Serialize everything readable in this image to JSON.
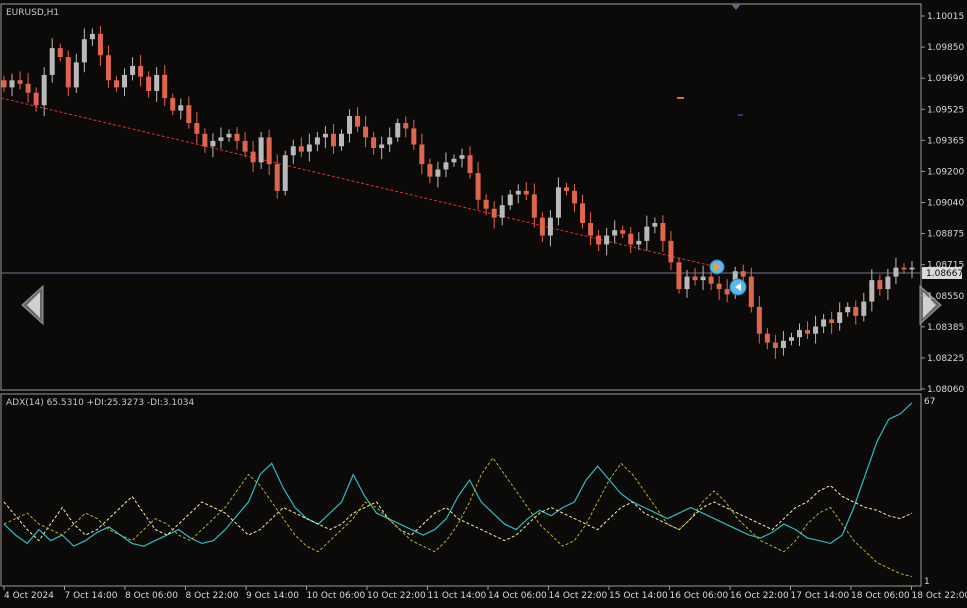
{
  "symbol_label": "EURUSD,H1",
  "indicator_label": "ADX(14) 65.5310 +DI:25.3273 -DI:3.1034",
  "current_price": "1.08667",
  "price_axis": [
    "1.10015",
    "1.09850",
    "1.09690",
    "1.09525",
    "1.09365",
    "1.09200",
    "1.09040",
    "1.08875",
    "1.08715",
    "1.08550",
    "1.08385",
    "1.08225",
    "1.08060"
  ],
  "indicator_axis": [
    "67",
    "1"
  ],
  "time_axis": [
    "4 Oct 2024",
    "7 Oct 14:00",
    "8 Oct 06:00",
    "8 Oct 22:00",
    "9 Oct 14:00",
    "10 Oct 06:00",
    "10 Oct 22:00",
    "11 Oct 14:00",
    "14 Oct 06:00",
    "14 Oct 22:00",
    "15 Oct 14:00",
    "16 Oct 06:00",
    "16 Oct 22:00",
    "17 Oct 14:00",
    "18 Oct 06:00",
    "18 Oct 22:00"
  ],
  "colors": {
    "background": "#0c0a08",
    "bull": "#b9b9b9",
    "bear": "#e0654d",
    "trendline": "#e03030",
    "adx": "#2fb9bf",
    "plus_di": "#f0f0b0",
    "minus_di": "#a8b436",
    "grid": "#3a3a3a",
    "price_line": "#6f7890"
  },
  "icons": {
    "nav_left": "left-arrow-icon",
    "nav_right": "right-arrow-icon",
    "sell_marker": "trade-marker-sell-icon",
    "buy_marker": "trade-marker-buy-icon"
  },
  "chart_data": [
    {
      "type": "candlestick",
      "title": "EURUSD,H1",
      "ylim": [
        1.0799,
        1.1008
      ],
      "close_series": [
        1.0968,
        1.0972,
        1.097,
        1.0965,
        1.0958,
        1.0975,
        1.099,
        1.0985,
        1.0968,
        1.0982,
        1.0995,
        1.0998,
        1.0986,
        1.0972,
        1.0968,
        1.0975,
        1.098,
        1.0974,
        1.0966,
        1.0975,
        1.0962,
        1.0955,
        1.0958,
        1.0948,
        1.0942,
        1.0935,
        1.0938,
        1.094,
        1.0942,
        1.0938,
        1.0932,
        1.0926,
        1.094,
        1.0925,
        1.091,
        1.093,
        1.0935,
        1.0932,
        1.0936,
        1.094,
        1.0942,
        1.0935,
        1.0942,
        1.0952,
        1.0946,
        1.094,
        1.0934,
        1.0936,
        1.094,
        1.0948,
        1.0945,
        1.0936,
        1.0925,
        1.0918,
        1.0922,
        1.0926,
        1.0928,
        1.093,
        1.092,
        1.0905,
        1.09,
        1.0895,
        1.0902,
        1.0908,
        1.091,
        1.0908,
        1.0895,
        1.0885,
        1.0895,
        1.0912,
        1.091,
        1.0903,
        1.0892,
        1.0885,
        1.088,
        1.0885,
        1.0888,
        1.0886,
        1.088,
        1.0882,
        1.089,
        1.0892,
        1.0882,
        1.087,
        1.0855,
        1.0862,
        1.086,
        1.0862,
        1.0858,
        1.0855,
        1.0852,
        1.0865,
        1.0862,
        1.0845,
        1.083,
        1.0825,
        1.0822,
        1.0826,
        1.0828,
        1.0832,
        1.083,
        1.0834,
        1.0838,
        1.0836,
        1.0842,
        1.0845,
        1.084,
        1.0848,
        1.086,
        1.0855,
        1.0862,
        1.0867,
        1.0866,
        1.0867
      ]
    },
    {
      "type": "line",
      "title": "ADX(14)",
      "ylim": [
        1,
        67
      ],
      "series": [
        {
          "name": "ADX",
          "values": [
            22,
            18,
            15,
            20,
            16,
            18,
            14,
            16,
            19,
            21,
            18,
            15,
            14,
            16,
            18,
            20,
            17,
            15,
            16,
            20,
            25,
            30,
            40,
            44,
            35,
            28,
            24,
            22,
            26,
            30,
            40,
            32,
            26,
            24,
            22,
            20,
            18,
            20,
            24,
            32,
            38,
            30,
            26,
            22,
            20,
            24,
            27,
            25,
            28,
            30,
            38,
            43,
            38,
            33,
            30,
            28,
            26,
            24,
            26,
            28,
            26,
            24,
            22,
            20,
            18,
            17,
            19,
            22,
            20,
            17,
            16,
            15,
            18,
            28,
            40,
            52,
            60,
            62,
            66
          ]
        },
        {
          "name": "+DI",
          "values": [
            30,
            25,
            20,
            16,
            22,
            28,
            22,
            18,
            20,
            24,
            28,
            32,
            26,
            20,
            18,
            22,
            26,
            30,
            28,
            26,
            22,
            18,
            20,
            24,
            28,
            26,
            24,
            22,
            20,
            22,
            26,
            28,
            30,
            24,
            20,
            18,
            22,
            26,
            28,
            24,
            22,
            20,
            18,
            16,
            18,
            22,
            26,
            28,
            26,
            24,
            22,
            20,
            24,
            28,
            30,
            26,
            24,
            22,
            20,
            24,
            28,
            30,
            28,
            26,
            24,
            22,
            20,
            24,
            28,
            30,
            34,
            36,
            32,
            30,
            28,
            27,
            25,
            24,
            26
          ]
        },
        {
          "name": "-DI",
          "values": [
            22,
            24,
            26,
            22,
            20,
            18,
            22,
            26,
            24,
            20,
            18,
            16,
            20,
            24,
            22,
            18,
            16,
            20,
            24,
            28,
            34,
            40,
            36,
            30,
            24,
            18,
            14,
            12,
            16,
            20,
            24,
            30,
            28,
            24,
            20,
            16,
            14,
            12,
            16,
            22,
            30,
            40,
            46,
            40,
            34,
            28,
            22,
            18,
            14,
            16,
            22,
            30,
            38,
            44,
            40,
            34,
            28,
            22,
            20,
            24,
            30,
            34,
            30,
            24,
            20,
            16,
            14,
            12,
            16,
            22,
            26,
            28,
            22,
            16,
            12,
            8,
            6,
            4,
            3
          ]
        }
      ]
    }
  ]
}
